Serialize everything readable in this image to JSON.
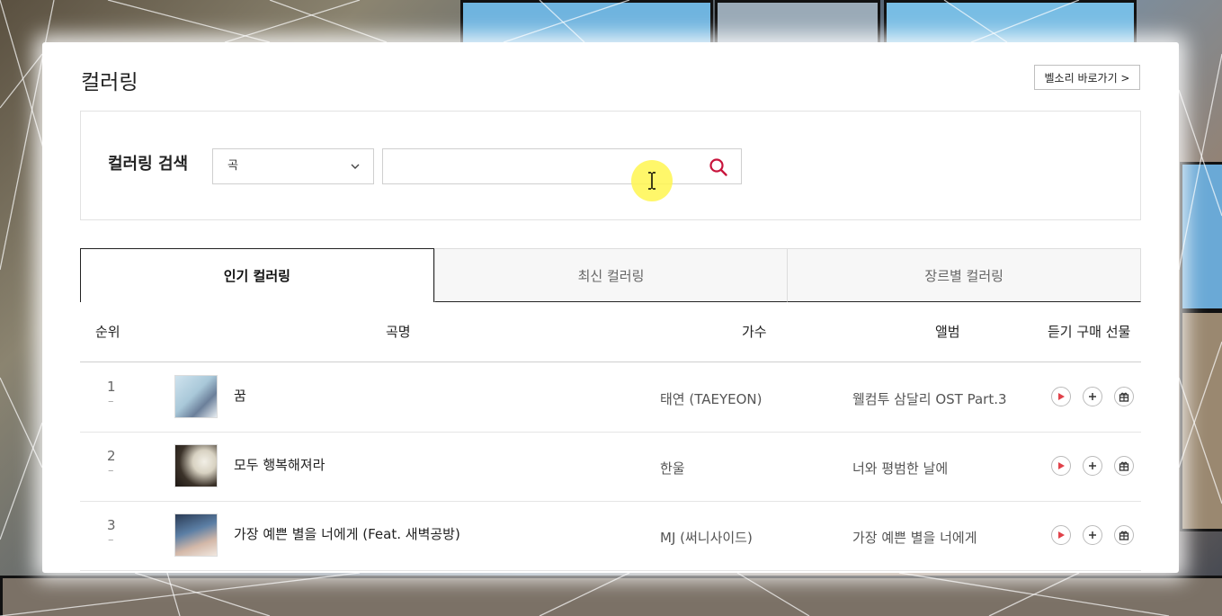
{
  "page": {
    "title": "컬러링",
    "bell_link": "벨소리 바로가기 >"
  },
  "search": {
    "label": "컬러링 검색",
    "select_value": "곡",
    "query": "",
    "placeholder": ""
  },
  "tabs": [
    {
      "label": "인기 컬러링",
      "active": true
    },
    {
      "label": "최신 컬러링",
      "active": false
    },
    {
      "label": "장르별 컬러링",
      "active": false
    }
  ],
  "table": {
    "headers": {
      "rank": "순위",
      "title": "곡명",
      "artist": "가수",
      "album": "앨범",
      "actions": "듣기 구매 선물"
    },
    "rows": [
      {
        "rank": "1",
        "change": "–",
        "title": "꿈",
        "artist": "태연 (TAEYEON)",
        "album": "웰컴투 삼달리 OST Part.3"
      },
      {
        "rank": "2",
        "change": "–",
        "title": "모두 행복해져라",
        "artist": "한울",
        "album": "너와 평범한 날에"
      },
      {
        "rank": "3",
        "change": "–",
        "title": "가장 예쁜 별을 너에게 (Feat. 새벽공방)",
        "artist": "MJ (써니사이드)",
        "album": "가장 예쁜 별을 너에게"
      }
    ]
  },
  "icons": {
    "search": "search-icon",
    "dropdown": "chevron-down-icon",
    "play": "play-icon",
    "add": "plus-icon",
    "gift": "gift-icon",
    "cursor": "text-cursor-icon"
  },
  "colors": {
    "accent": "#c8143c",
    "play": "#e0424a"
  }
}
